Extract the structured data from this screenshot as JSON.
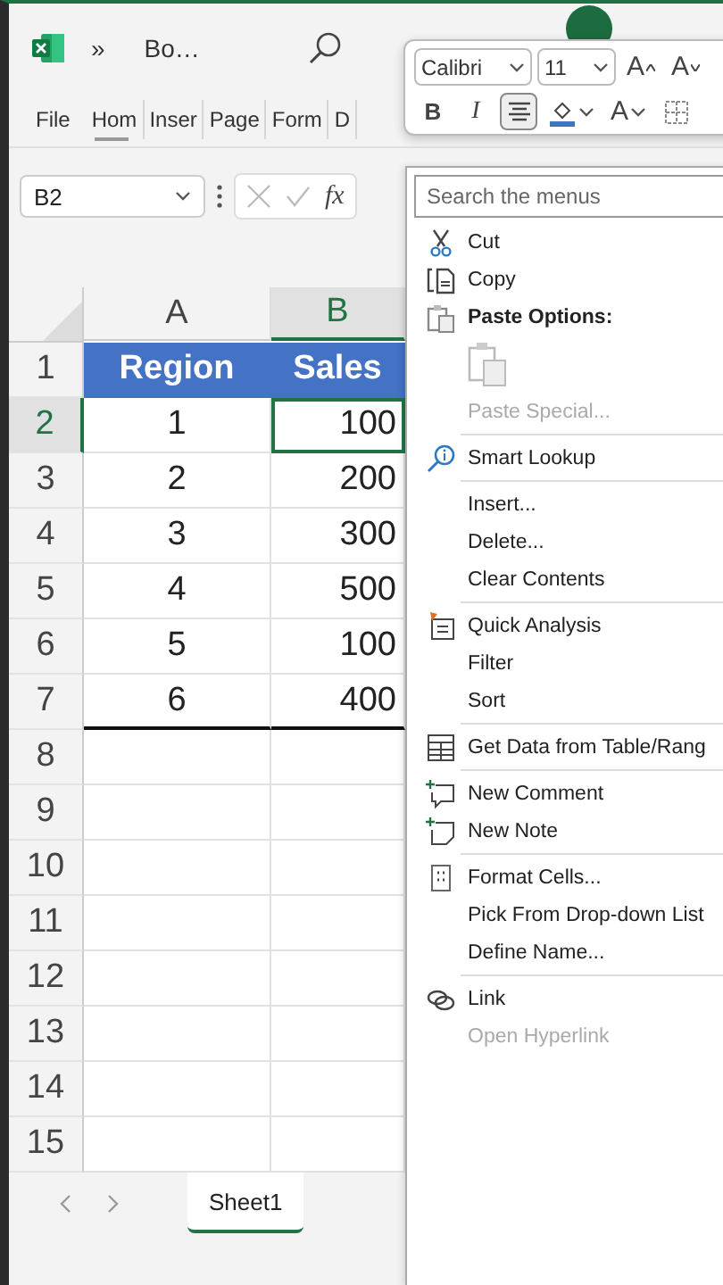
{
  "title_bar": {
    "overflow": "»",
    "file_name": "Bo…"
  },
  "ribbon_tabs": [
    {
      "label": "File",
      "selected": false
    },
    {
      "label": "Hom",
      "selected": true
    },
    {
      "label": "Inser",
      "selected": false
    },
    {
      "label": "Page",
      "selected": false
    },
    {
      "label": "Form",
      "selected": false
    },
    {
      "label": "D",
      "selected": false
    }
  ],
  "formula_bar": {
    "name_box": "B2",
    "function_label": "fx"
  },
  "mini_toolbar": {
    "font": "Calibri",
    "size": "11",
    "top_buttons": [
      {
        "kind": "grow",
        "label": "A",
        "on": false
      },
      {
        "kind": "shrink",
        "label": "A",
        "on": false
      }
    ],
    "bottom_buttons": [
      {
        "kind": "bold",
        "label": "B",
        "on": false
      },
      {
        "kind": "italic",
        "label": "I",
        "on": false
      },
      {
        "kind": "align",
        "on": true
      },
      {
        "kind": "fill",
        "on": false
      },
      {
        "kind": "font_color",
        "label": "A",
        "on": false
      },
      {
        "kind": "borders",
        "on": false
      }
    ]
  },
  "sheet": {
    "columns": [
      {
        "label": "A",
        "selected": false
      },
      {
        "label": "B",
        "selected": true
      }
    ],
    "rows": [
      {
        "label": "1",
        "kind": "header",
        "selected": false,
        "cells": [
          {
            "text": "Region",
            "selected": false
          },
          {
            "text": "Sales",
            "selected": false
          }
        ]
      },
      {
        "label": "2",
        "kind": "data",
        "selected": true,
        "cells": [
          {
            "text": "1",
            "selected": false
          },
          {
            "text": "100",
            "selected": true
          }
        ]
      },
      {
        "label": "3",
        "kind": "data",
        "selected": false,
        "cells": [
          {
            "text": "2",
            "selected": false
          },
          {
            "text": "200",
            "selected": false
          }
        ]
      },
      {
        "label": "4",
        "kind": "data",
        "selected": false,
        "cells": [
          {
            "text": "3",
            "selected": false
          },
          {
            "text": "300",
            "selected": false
          }
        ]
      },
      {
        "label": "5",
        "kind": "data",
        "selected": false,
        "cells": [
          {
            "text": "4",
            "selected": false
          },
          {
            "text": "500",
            "selected": false
          }
        ]
      },
      {
        "label": "6",
        "kind": "data",
        "selected": false,
        "cells": [
          {
            "text": "5",
            "selected": false
          },
          {
            "text": "100",
            "selected": false
          }
        ]
      },
      {
        "label": "7",
        "kind": "data",
        "selected": false,
        "cells": [
          {
            "text": "6",
            "selected": false
          },
          {
            "text": "400",
            "selected": false
          }
        ]
      },
      {
        "label": "8",
        "kind": "empty",
        "selected": false
      },
      {
        "label": "9",
        "kind": "empty",
        "selected": false
      },
      {
        "label": "10",
        "kind": "empty",
        "selected": false
      },
      {
        "label": "11",
        "kind": "empty",
        "selected": false
      },
      {
        "label": "12",
        "kind": "empty",
        "selected": false
      },
      {
        "label": "13",
        "kind": "empty",
        "selected": false
      },
      {
        "label": "14",
        "kind": "empty",
        "selected": false
      },
      {
        "label": "15",
        "kind": "empty",
        "selected": false
      }
    ]
  },
  "sheet_tabs": [
    {
      "label": "Sheet1",
      "selected": true
    }
  ],
  "context_menu": {
    "search": {
      "placeholder": "Search the menus"
    },
    "groups": [
      {
        "items": [
          {
            "kind": "command",
            "label": "Cut",
            "disabled": false
          },
          {
            "kind": "command",
            "label": "Copy",
            "disabled": false
          },
          {
            "kind": "heading",
            "label": "Paste Options:",
            "disabled": false
          },
          {
            "kind": "paste_icons",
            "disabled": true
          },
          {
            "kind": "command",
            "label": "Paste Special...",
            "disabled": true
          }
        ]
      },
      {
        "items": [
          {
            "kind": "command",
            "label": "Smart Lookup",
            "disabled": false
          }
        ]
      },
      {
        "items": [
          {
            "kind": "command",
            "label": "Insert...",
            "disabled": false
          },
          {
            "kind": "command",
            "label": "Delete...",
            "disabled": false
          },
          {
            "kind": "command",
            "label": "Clear Contents",
            "disabled": false
          }
        ]
      },
      {
        "items": [
          {
            "kind": "command",
            "label": "Quick Analysis",
            "disabled": false
          },
          {
            "kind": "command",
            "label": "Filter",
            "disabled": false
          },
          {
            "kind": "command",
            "label": "Sort",
            "disabled": false
          }
        ]
      },
      {
        "items": [
          {
            "kind": "command",
            "label": "Get Data from Table/Rang",
            "disabled": false
          }
        ]
      },
      {
        "items": [
          {
            "kind": "command",
            "label": "New Comment",
            "disabled": false
          },
          {
            "kind": "command",
            "label": "New Note",
            "disabled": false
          }
        ]
      },
      {
        "items": [
          {
            "kind": "command",
            "label": "Format Cells...",
            "disabled": false
          },
          {
            "kind": "command",
            "label": "Pick From Drop-down List",
            "disabled": false
          },
          {
            "kind": "command",
            "label": "Define Name...",
            "disabled": false
          }
        ]
      },
      {
        "items": [
          {
            "kind": "command",
            "label": "Link",
            "disabled": false
          },
          {
            "kind": "command",
            "label": "Open Hyperlink",
            "disabled": true
          }
        ]
      }
    ]
  }
}
